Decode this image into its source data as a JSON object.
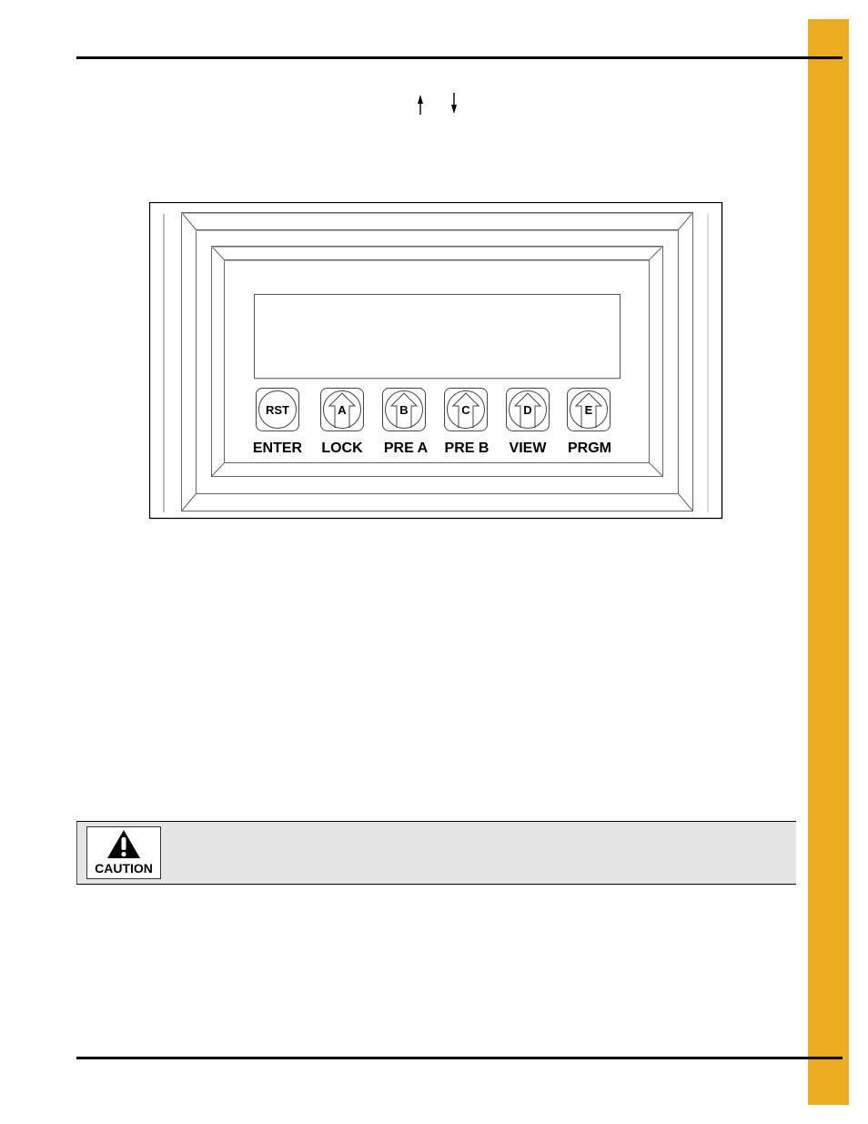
{
  "page": {
    "tab_color": "#EAAD22",
    "rule_color": "#000000"
  },
  "header_arrows": [
    {
      "name": "up-arrow-icon",
      "glyph": "↑"
    },
    {
      "name": "down-arrow-icon",
      "glyph": "↓"
    }
  ],
  "figure": {
    "description": "Controller front panel with display and six keys",
    "display_text": "",
    "keys": [
      {
        "id": "rst",
        "face": "RST",
        "label": "ENTER",
        "style": "round"
      },
      {
        "id": "a",
        "face": "A",
        "label": "LOCK",
        "style": "arrow"
      },
      {
        "id": "b",
        "face": "B",
        "label": "PRE A",
        "style": "arrow"
      },
      {
        "id": "c",
        "face": "C",
        "label": "PRE B",
        "style": "arrow"
      },
      {
        "id": "d",
        "face": "D",
        "label": "VIEW",
        "style": "arrow"
      },
      {
        "id": "e",
        "face": "E",
        "label": "PRGM",
        "style": "arrow"
      }
    ]
  },
  "caution": {
    "label": "CAUTION",
    "background": "#E5E5E5",
    "text": ""
  }
}
